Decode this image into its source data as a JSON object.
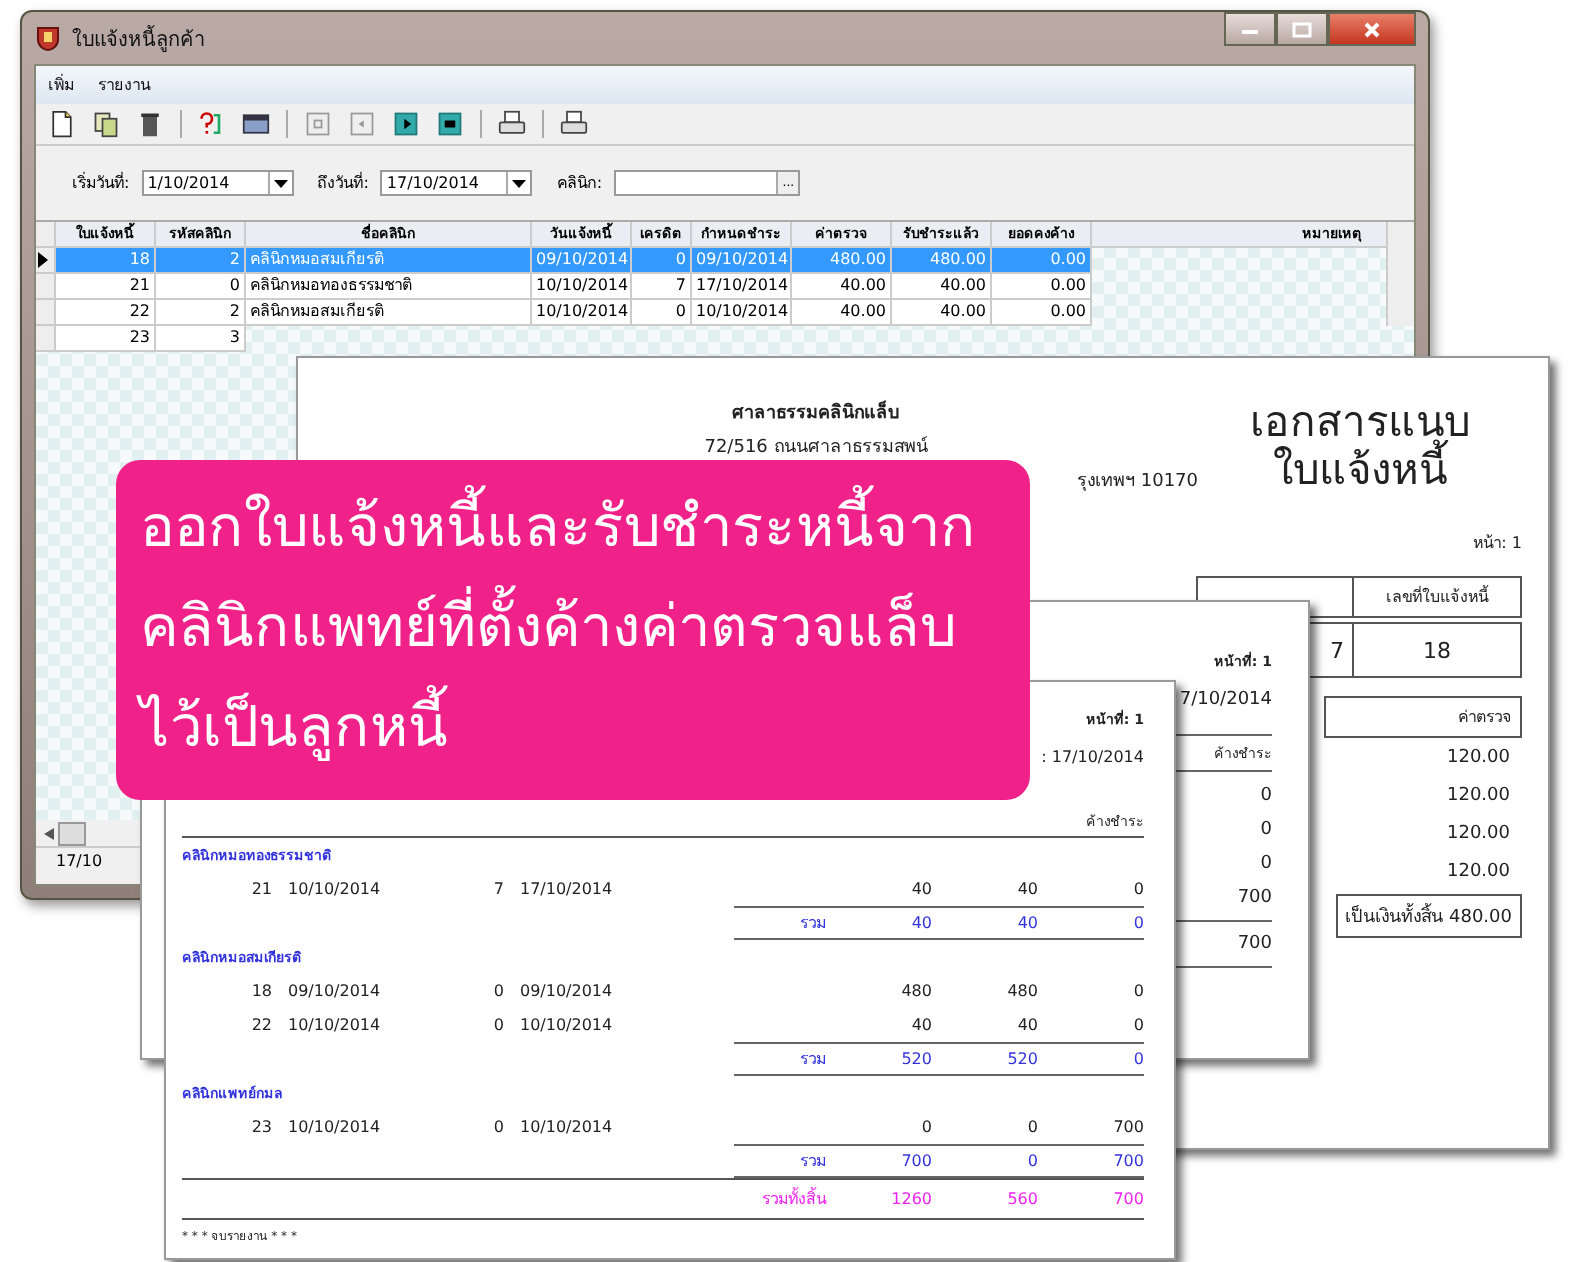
{
  "window": {
    "title": "ใบแจ้งหนี้ลูกค้า",
    "menu": [
      {
        "label": "เพิ่ม"
      },
      {
        "label": "รายงาน"
      }
    ],
    "toolbar": [
      {
        "kind": "new"
      },
      {
        "kind": "copy"
      },
      {
        "kind": "delete"
      },
      {
        "kind": "separator"
      },
      {
        "kind": "query"
      },
      {
        "kind": "grid"
      },
      {
        "kind": "separator"
      },
      {
        "kind": "first"
      },
      {
        "kind": "prev"
      },
      {
        "kind": "next"
      },
      {
        "kind": "last"
      },
      {
        "kind": "separator"
      },
      {
        "kind": "print"
      },
      {
        "kind": "separator"
      },
      {
        "kind": "print"
      }
    ],
    "filters": [
      {
        "kind": "date",
        "label": "เริ่มวันที่:",
        "value": "1/10/2014"
      },
      {
        "kind": "date",
        "label": "ถึงวันที่:",
        "value": "17/10/2014"
      },
      {
        "kind": "lookup",
        "label": "คลินิก:",
        "button_label": "..."
      }
    ],
    "table": {
      "columns": [
        "ใบแจ้งหนี้",
        "รหัสคลินิก",
        "ชื่อคลินิก",
        "วันแจ้งหนี้",
        "เครดิต",
        "กำหนดชำระ",
        "ค่าตรวจ",
        "รับชำระแล้ว",
        "ยอดคงค้าง",
        "หมายเหตุ"
      ],
      "rows": [
        {
          "selected": true,
          "cells": [
            "18",
            "2",
            "คลินิกหมอสมเกียรติ",
            "09/10/2014",
            "0",
            "09/10/2014",
            "480.00",
            "480.00",
            "0.00"
          ]
        },
        {
          "selected": false,
          "cells": [
            "21",
            "0",
            "คลินิกหมอทองธรรมชาติ",
            "10/10/2014",
            "7",
            "17/10/2014",
            "40.00",
            "40.00",
            "0.00"
          ]
        },
        {
          "selected": false,
          "cells": [
            "22",
            "2",
            "คลินิกหมอสมเกียรติ",
            "10/10/2014",
            "0",
            "10/10/2014",
            "40.00",
            "40.00",
            "0.00"
          ]
        },
        {
          "selected": false,
          "cells": [
            "23",
            "3"
          ]
        }
      ]
    },
    "status_bar": {
      "text": "17/10"
    }
  },
  "invoice_document": {
    "company": "ศาลาธรรมคลินิกแล็บ",
    "address_lines": [
      "72/516 ถนนศาลาธรรมสพน์",
      "รุงเทพฯ 10170"
    ],
    "title_lines": [
      "เอกสารแนบ",
      "ใบแจ้งหนี้"
    ],
    "page": "หน้า: 1",
    "invoice_header": "เลขที่ใบแจ้งหนี้",
    "invoice_row": [
      "7",
      "18"
    ],
    "fee_header": "ค่าตรวจ",
    "fees": [
      "120.00",
      "120.00",
      "120.00",
      "120.00"
    ],
    "total": "เป็นเงินทั้งสิ้น 480.00"
  },
  "summary_report": {
    "page": "หน้าที่: 1",
    "date": "7/10/2014",
    "column": "ค้างชำระ",
    "values": [
      "0",
      "0",
      "0",
      "700"
    ],
    "total": "700"
  },
  "detail_report": {
    "page": "หน้าที่: 1",
    "date": ": 17/10/2014",
    "column": "ค้างชำระ",
    "groups": [
      {
        "name": "คลินิกหมอทองธรรมชาติ",
        "rows": [
          [
            "21",
            "10/10/2014",
            "7",
            "17/10/2014",
            "40",
            "40",
            "0"
          ]
        ],
        "subtotal": {
          "label": "รวม",
          "values": [
            "40",
            "40",
            "0"
          ]
        }
      },
      {
        "name": "คลินิกหมอสมเกียรติ",
        "rows": [
          [
            "18",
            "09/10/2014",
            "0",
            "09/10/2014",
            "480",
            "480",
            "0"
          ],
          [
            "22",
            "10/10/2014",
            "0",
            "10/10/2014",
            "40",
            "40",
            "0"
          ]
        ],
        "subtotal": {
          "label": "รวม",
          "values": [
            "520",
            "520",
            "0"
          ]
        }
      },
      {
        "name": "คลินิกแพทย์กมล",
        "rows": [
          [
            "23",
            "10/10/2014",
            "0",
            "10/10/2014",
            "0",
            "0",
            "700"
          ]
        ],
        "subtotal": {
          "label": "รวม",
          "values": [
            "700",
            "0",
            "700"
          ]
        }
      }
    ],
    "grand_total": {
      "label": "รวมทั้งสิ้น",
      "values": [
        "1260",
        "560",
        "700"
      ]
    },
    "footer": "* * * จบรายงาน * * *"
  },
  "callout": {
    "lines": [
      "ออกใบแจ้งหนี้และรับชำระหนี้จาก",
      "คลินิกแพทย์ที่ตั้งค้างค่าตรวจแล็บ",
      "ไว้เป็นลูกหนี้"
    ]
  }
}
